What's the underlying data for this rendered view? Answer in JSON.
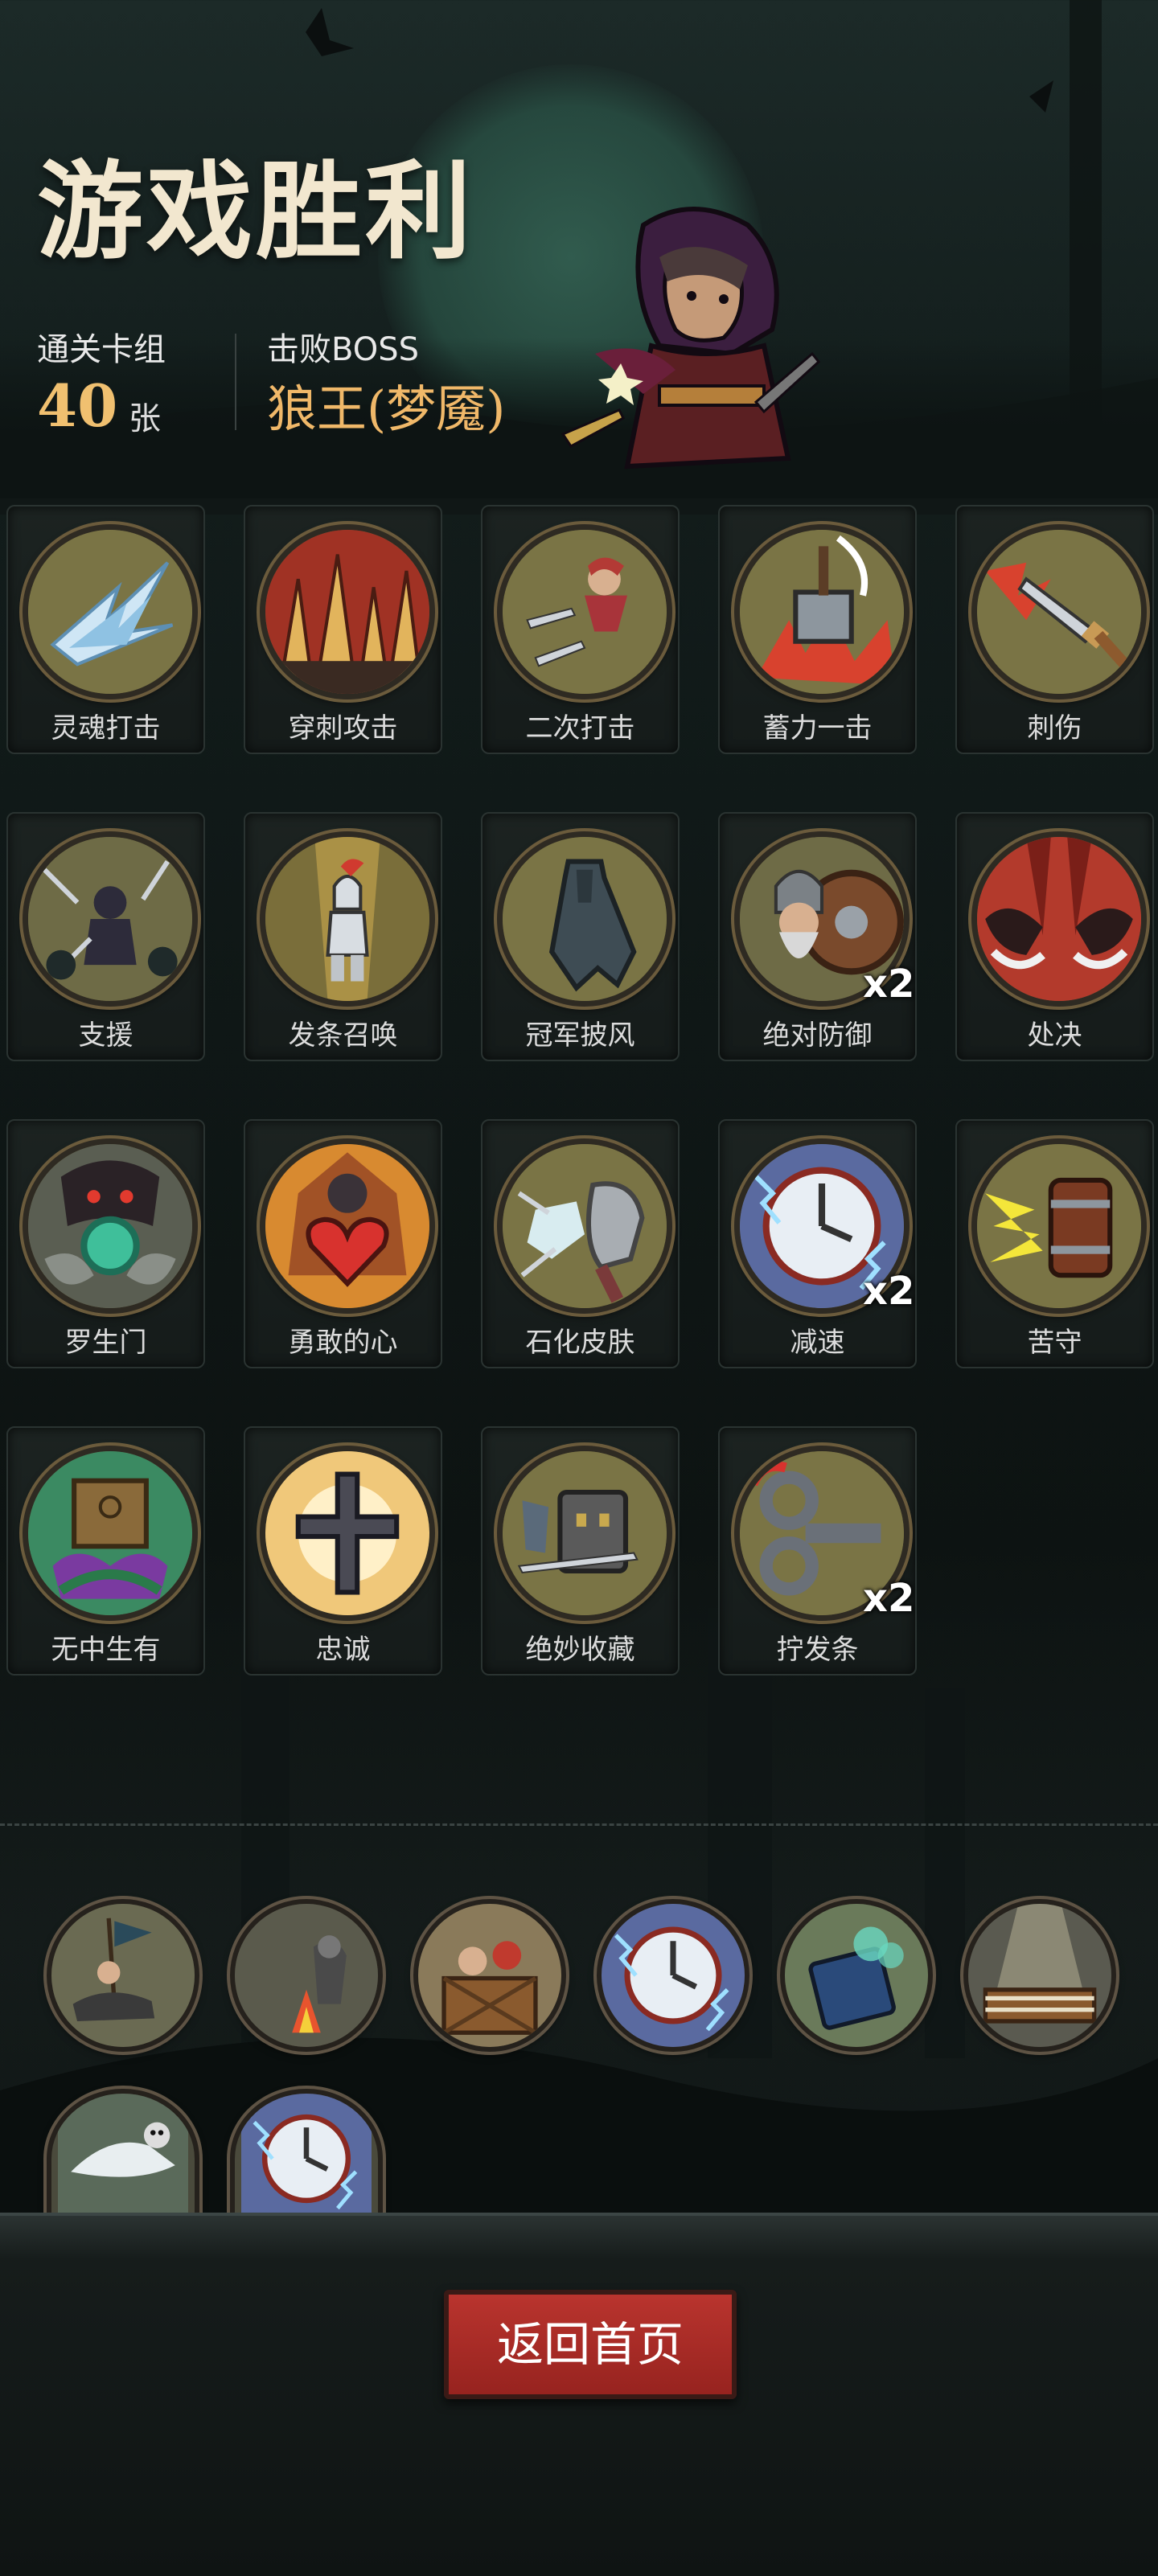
{
  "header": {
    "title": "游戏胜利",
    "cards_label": "通关卡组",
    "cards_count": "40",
    "cards_unit": "张",
    "boss_label": "击败BOSS",
    "boss_name": "狼王(梦魇)"
  },
  "cards": [
    {
      "name": "灵魂打击",
      "icon": "ice-shards-icon"
    },
    {
      "name": "穿刺攻击",
      "icon": "spikes-icon"
    },
    {
      "name": "二次打击",
      "icon": "hero-daggers-icon"
    },
    {
      "name": "蓄力一击",
      "icon": "hammer-smash-icon"
    },
    {
      "name": "刺伤",
      "icon": "dagger-icon"
    },
    {
      "name": "支援",
      "icon": "support-allies-icon"
    },
    {
      "name": "发条召唤",
      "icon": "clockwork-knight-icon"
    },
    {
      "name": "冠军披风",
      "icon": "cloak-icon"
    },
    {
      "name": "绝对防御",
      "icon": "dwarf-shield-icon",
      "count": "x2"
    },
    {
      "name": "处决",
      "icon": "execution-icon"
    },
    {
      "name": "罗生门",
      "icon": "demon-gate-icon"
    },
    {
      "name": "勇敢的心",
      "icon": "brave-heart-icon"
    },
    {
      "name": "石化皮肤",
      "icon": "stone-fist-icon"
    },
    {
      "name": "减速",
      "icon": "slow-clock-icon",
      "count": "x2"
    },
    {
      "name": "苦守",
      "icon": "barrel-guard-icon"
    },
    {
      "name": "无中生有",
      "icon": "mystery-box-icon"
    },
    {
      "name": "忠诚",
      "icon": "cross-icon"
    },
    {
      "name": "绝妙收藏",
      "icon": "book-sword-icon"
    },
    {
      "name": "拧发条",
      "icon": "wind-up-key-icon",
      "count": "x2"
    }
  ],
  "relics": [
    {
      "icon": "rider-banner-icon"
    },
    {
      "icon": "campfire-knight-icon"
    },
    {
      "icon": "crate-friends-icon"
    },
    {
      "icon": "slow-clock-icon"
    },
    {
      "icon": "spell-book-icon"
    },
    {
      "icon": "boxing-ring-icon"
    },
    {
      "icon": "skull-blade-icon"
    },
    {
      "icon": "slow-clock-icon"
    }
  ],
  "footer": {
    "home_button": "返回首页"
  },
  "colors": {
    "accent_gold": "#f0b869",
    "count_gold": "#f0c070",
    "button_red": "#b9342e",
    "card_bg": "#1c2321"
  }
}
